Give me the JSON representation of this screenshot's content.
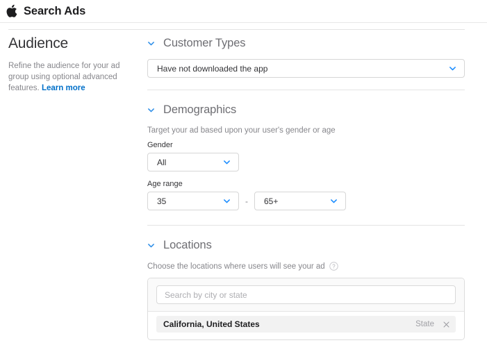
{
  "header": {
    "logo_icon": "apple-logo-icon",
    "title": "Search Ads"
  },
  "sidebar": {
    "title": "Audience",
    "description": "Refine the audience for your ad group using optional advanced features.",
    "learn_more_label": "Learn more"
  },
  "colors": {
    "accent_blue": "#0070c9",
    "caret_blue": "#2f8fe8",
    "heading_gray": "#6e6e73",
    "muted_gray": "#86868b",
    "border_gray": "#d6d6d6",
    "divider_gray": "#e4e4e4",
    "chip_bg": "#f2f2f2",
    "panel_bg": "#fafafa"
  },
  "sections": {
    "customer_types": {
      "title": "Customer Types",
      "caret_icon": "chevron-down-icon",
      "select": {
        "value": "Have not downloaded the app",
        "caret_icon": "chevron-down-icon"
      }
    },
    "demographics": {
      "title": "Demographics",
      "caret_icon": "chevron-down-icon",
      "description": "Target your ad based upon your user's gender or age",
      "gender": {
        "label": "Gender",
        "value": "All",
        "caret_icon": "chevron-down-icon"
      },
      "age_range": {
        "label": "Age range",
        "from_value": "35",
        "to_value": "65+",
        "separator": "-",
        "caret_icon": "chevron-down-icon"
      }
    },
    "locations": {
      "title": "Locations",
      "caret_icon": "chevron-down-icon",
      "description": "Choose the locations where users will see your ad",
      "help_icon": "question-circle-icon",
      "search_placeholder": "Search by city or state",
      "search_value": "",
      "selected": [
        {
          "name": "California, United States",
          "type": "State",
          "remove_icon": "close-icon"
        }
      ]
    }
  }
}
